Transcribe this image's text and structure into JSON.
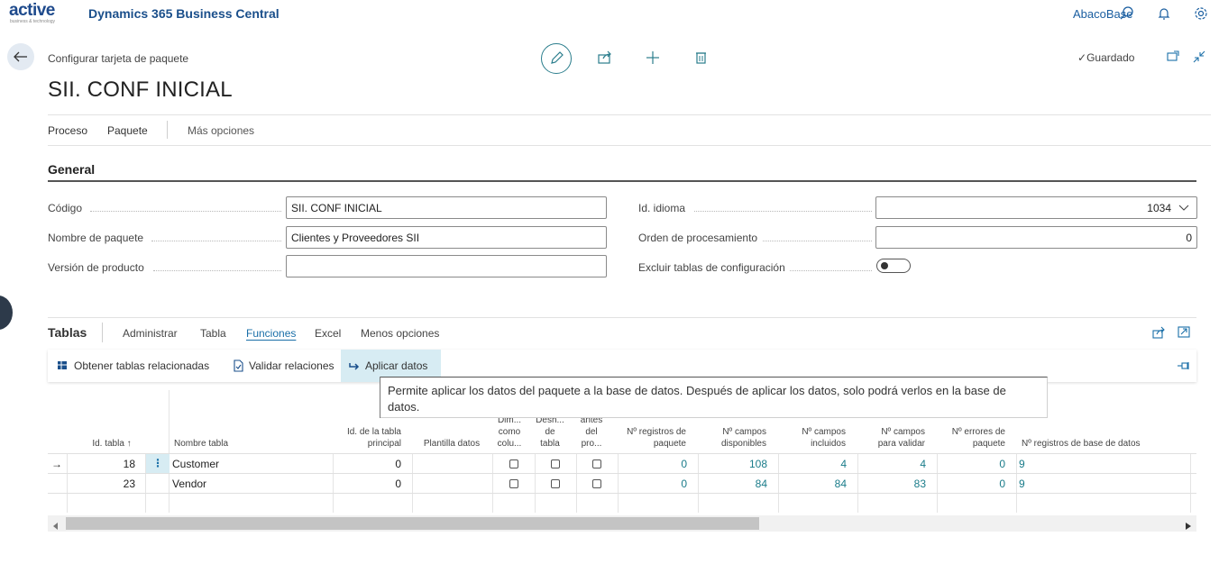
{
  "top": {
    "logo_main": "active",
    "logo_sub": "business & technology",
    "app_name": "Dynamics 365 Business Central",
    "company": "AbacoBase",
    "icons": [
      "search-icon",
      "bell-icon",
      "gear-icon"
    ]
  },
  "header": {
    "breadcrumb": "Configurar tarjeta de paquete",
    "title": "SII. CONF INICIAL",
    "saved": "Guardado",
    "actions": [
      "edit-icon",
      "share-icon",
      "add-icon",
      "delete-icon"
    ]
  },
  "menu": {
    "items": [
      "Proceso",
      "Paquete"
    ],
    "more": "Más opciones"
  },
  "general": {
    "title": "General",
    "fields": {
      "codigo_label": "Código",
      "codigo_value": "SII. CONF INICIAL",
      "nombre_label": "Nombre de paquete",
      "nombre_value": "Clientes y Proveedores SII",
      "version_label": "Versión de producto",
      "version_value": "",
      "idioma_label": "Id. idioma",
      "idioma_value": "1034",
      "orden_label": "Orden de procesamiento",
      "orden_value": "0",
      "excluir_label": "Excluir tablas de configuración",
      "excluir_value": false
    }
  },
  "tablas": {
    "title": "Tablas",
    "tabs": [
      "Administrar",
      "Tabla",
      "Funciones",
      "Excel",
      "Menos opciones"
    ],
    "active_tab": "Funciones",
    "actions": {
      "obtener": "Obtener tablas relacionadas",
      "validar": "Validar relaciones",
      "aplicar": "Aplicar datos"
    },
    "tooltip": "Permite aplicar los datos del paquete a la base de datos. Después de aplicar los datos, solo podrá verlos en la base de datos.",
    "columns": {
      "id_tabla": "Id. tabla ↑",
      "nombre_tabla": "Nombre tabla",
      "id_principal": "Id. de la tabla principal",
      "plantilla": "Plantilla datos",
      "dim_col": "Dim... como colu...",
      "desh": "Desh... de tabla",
      "antes": "antes del pro...",
      "n_reg_paquete": "Nº registros de paquete",
      "n_campos_disp": "Nº campos disponibles",
      "n_campos_incl": "Nº campos incluidos",
      "n_campos_valid": "Nº campos para validar",
      "n_errores": "Nº errores de paquete",
      "n_reg_bd": "Nº registros de base de datos"
    },
    "rows": [
      {
        "id": "18",
        "name": "Customer",
        "principal": "0",
        "reg_paquete": "0",
        "disp": "108",
        "incl": "4",
        "valid": "4",
        "errores": "0",
        "reg_bd": "9"
      },
      {
        "id": "23",
        "name": "Vendor",
        "principal": "0",
        "reg_paquete": "0",
        "disp": "84",
        "incl": "84",
        "valid": "83",
        "errores": "0",
        "reg_bd": "9"
      }
    ]
  }
}
